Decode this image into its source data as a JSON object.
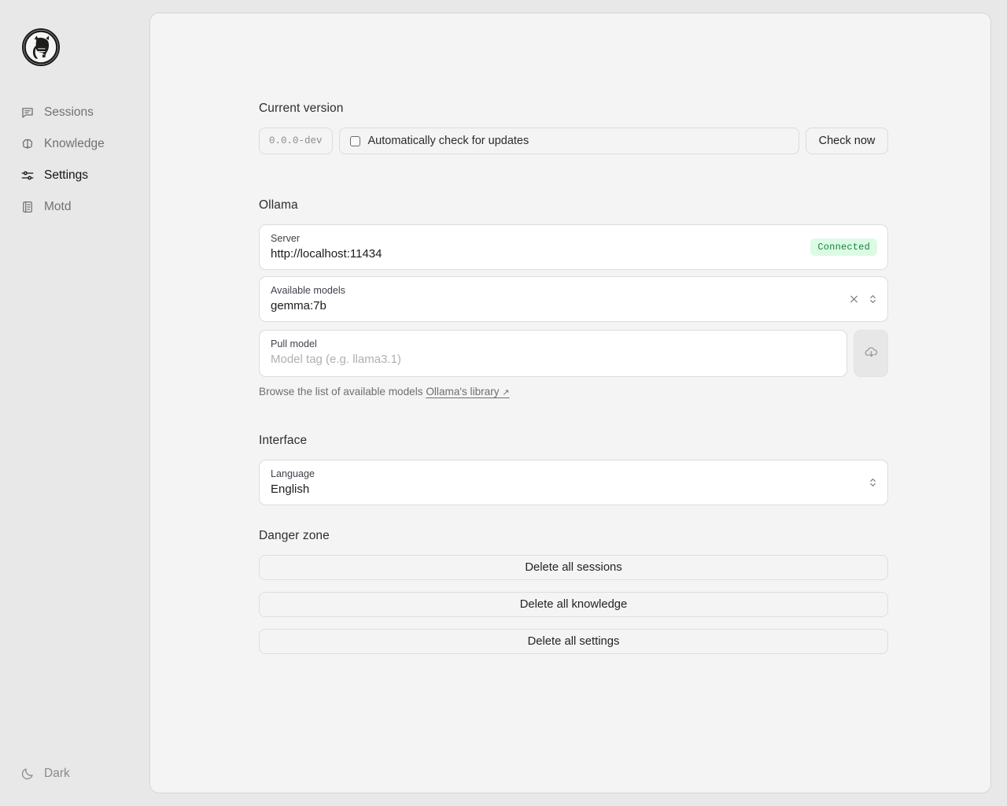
{
  "app": {
    "logo_name": "llama-logo"
  },
  "sidebar": {
    "items": [
      {
        "label": "Sessions",
        "icon": "chat-bubble-icon",
        "active": false
      },
      {
        "label": "Knowledge",
        "icon": "brain-icon",
        "active": false
      },
      {
        "label": "Settings",
        "icon": "sliders-icon",
        "active": true
      },
      {
        "label": "Motd",
        "icon": "notebook-icon",
        "active": false
      }
    ],
    "theme_toggle": {
      "label": "Dark",
      "icon": "moon-icon"
    }
  },
  "main": {
    "version": {
      "title": "Current version",
      "badge": "0.0.0-dev",
      "auto_check_label": "Automatically check for updates",
      "auto_check_checked": false,
      "check_now_label": "Check now"
    },
    "ollama": {
      "title": "Ollama",
      "server": {
        "label": "Server",
        "value": "http://localhost:11434",
        "status": "Connected",
        "status_color": "#17803d",
        "status_bg": "#dcfbe5"
      },
      "available_models": {
        "label": "Available models",
        "value": "gemma:7b",
        "clear_icon": "close-icon",
        "chevron_icon": "chevron-up-down-icon"
      },
      "pull_model": {
        "label": "Pull model",
        "value": "",
        "placeholder": "Model tag (e.g. llama3.1)",
        "button_icon": "cloud-download-icon"
      },
      "helper_text": "Browse the list of available models",
      "helper_link": "Ollama's library",
      "helper_link_arrow": "↗"
    },
    "interface": {
      "title": "Interface",
      "language": {
        "label": "Language",
        "value": "English",
        "chevron_icon": "chevron-up-down-icon"
      }
    },
    "danger_zone": {
      "title": "Danger zone",
      "buttons": [
        "Delete all sessions",
        "Delete all knowledge",
        "Delete all settings"
      ]
    }
  }
}
